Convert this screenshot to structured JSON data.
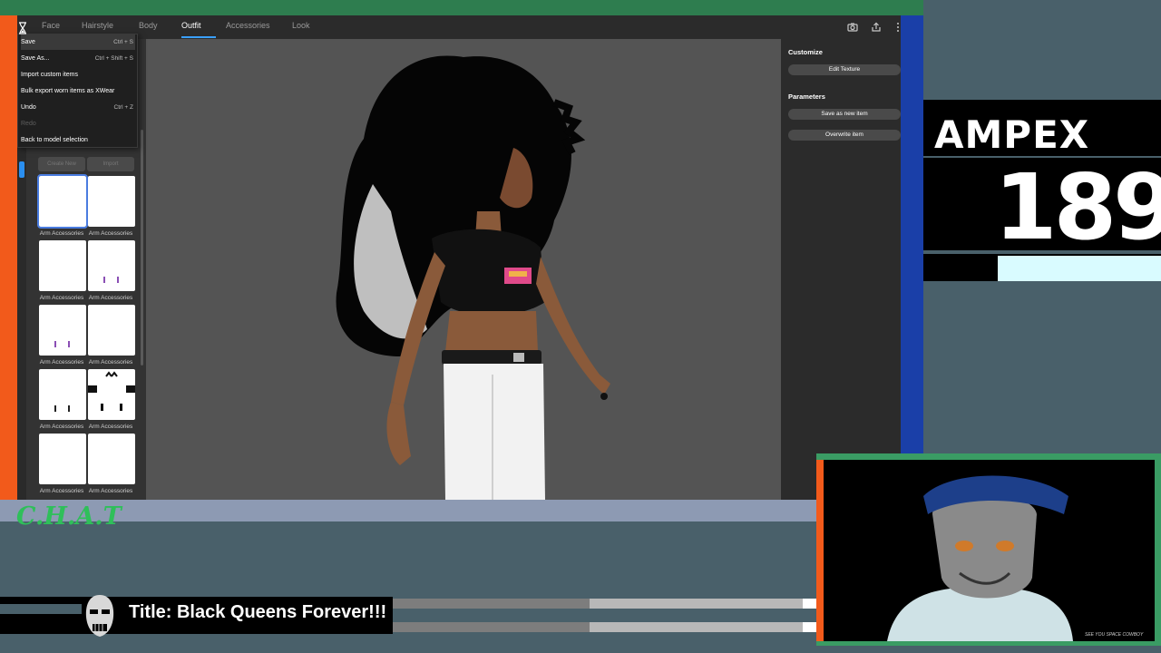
{
  "app": {
    "tabs": [
      {
        "label": "Face"
      },
      {
        "label": "Hairstyle"
      },
      {
        "label": "Body"
      },
      {
        "label": "Outfit"
      },
      {
        "label": "Accessories"
      },
      {
        "label": "Look"
      }
    ],
    "active_tab": "Outfit",
    "menu": {
      "items": [
        {
          "label": "Save",
          "shortcut": "Ctrl + S"
        },
        {
          "label": "Save As...",
          "shortcut": "Ctrl + Shift + S"
        },
        {
          "label": "Import custom items",
          "shortcut": ""
        },
        {
          "label": "Bulk export worn items as XWear",
          "shortcut": ""
        },
        {
          "label": "Undo",
          "shortcut": "Ctrl + Z"
        },
        {
          "label": "Redo",
          "shortcut": ""
        },
        {
          "label": "Back to model selection",
          "shortcut": ""
        }
      ]
    },
    "left_panel": {
      "create_new_label": "Create New",
      "import_label": "Import",
      "items": [
        {
          "label": "Arm Accessories"
        },
        {
          "label": "Arm Accessories"
        },
        {
          "label": "Arm Accessories"
        },
        {
          "label": "Arm Accessories"
        },
        {
          "label": "Arm Accessories"
        },
        {
          "label": "Arm Accessories"
        },
        {
          "label": "Arm Accessories"
        },
        {
          "label": "Arm Accessories"
        },
        {
          "label": "Arm Accessories"
        },
        {
          "label": "Arm Accessories"
        }
      ]
    },
    "right_panel": {
      "customize_title": "Customize",
      "edit_texture_label": "Edit Texture",
      "parameters_title": "Parameters",
      "save_as_new_label": "Save as new item",
      "overwrite_label": "Overwrite item"
    }
  },
  "overlay": {
    "streamer_name": "AMPEX",
    "stream_number": "189",
    "chat_label": "C.H.A.T",
    "stream_title": "Title: Black Queens Forever!!!",
    "cam_caption": "SEE YOU SPACE COWBOY"
  },
  "colors": {
    "accent_blue": "#3aa0ff",
    "overlay_green": "#2e7d4f",
    "overlay_orange": "#f25a1b",
    "overlay_slate": "#49606a",
    "chat_green": "#2fbf5a"
  }
}
